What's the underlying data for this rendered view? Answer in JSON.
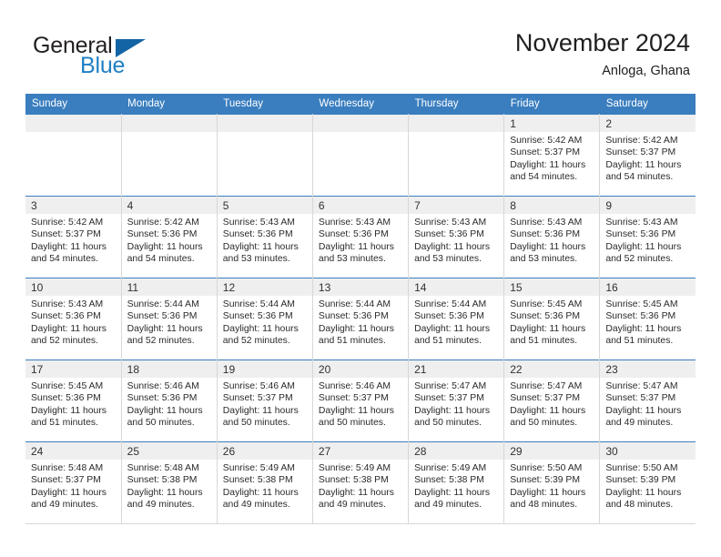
{
  "brand": {
    "name_part1": "General",
    "name_part2": "Blue",
    "triangle_color": "#1364a5",
    "accent_color": "#1f7fc4"
  },
  "header": {
    "title": "November 2024",
    "subtitle": "Anloga, Ghana"
  },
  "theme": {
    "header_bg": "#3a7ebf",
    "header_text": "#ffffff",
    "daynum_band_bg": "#efefef",
    "cell_bg": "#ffffff",
    "grid_line": "#d7d7d7"
  },
  "weekday_headers": [
    "Sunday",
    "Monday",
    "Tuesday",
    "Wednesday",
    "Thursday",
    "Friday",
    "Saturday"
  ],
  "weeks": [
    [
      {
        "day": "",
        "empty": true,
        "sunrise": "",
        "sunset": "",
        "daylight_line1": "",
        "daylight_line2": ""
      },
      {
        "day": "",
        "empty": true,
        "sunrise": "",
        "sunset": "",
        "daylight_line1": "",
        "daylight_line2": ""
      },
      {
        "day": "",
        "empty": true,
        "sunrise": "",
        "sunset": "",
        "daylight_line1": "",
        "daylight_line2": ""
      },
      {
        "day": "",
        "empty": true,
        "sunrise": "",
        "sunset": "",
        "daylight_line1": "",
        "daylight_line2": ""
      },
      {
        "day": "",
        "empty": true,
        "sunrise": "",
        "sunset": "",
        "daylight_line1": "",
        "daylight_line2": ""
      },
      {
        "day": "1",
        "empty": false,
        "sunrise": "Sunrise: 5:42 AM",
        "sunset": "Sunset: 5:37 PM",
        "daylight_line1": "Daylight: 11 hours",
        "daylight_line2": "and 54 minutes."
      },
      {
        "day": "2",
        "empty": false,
        "sunrise": "Sunrise: 5:42 AM",
        "sunset": "Sunset: 5:37 PM",
        "daylight_line1": "Daylight: 11 hours",
        "daylight_line2": "and 54 minutes."
      }
    ],
    [
      {
        "day": "3",
        "empty": false,
        "sunrise": "Sunrise: 5:42 AM",
        "sunset": "Sunset: 5:37 PM",
        "daylight_line1": "Daylight: 11 hours",
        "daylight_line2": "and 54 minutes."
      },
      {
        "day": "4",
        "empty": false,
        "sunrise": "Sunrise: 5:42 AM",
        "sunset": "Sunset: 5:36 PM",
        "daylight_line1": "Daylight: 11 hours",
        "daylight_line2": "and 54 minutes."
      },
      {
        "day": "5",
        "empty": false,
        "sunrise": "Sunrise: 5:43 AM",
        "sunset": "Sunset: 5:36 PM",
        "daylight_line1": "Daylight: 11 hours",
        "daylight_line2": "and 53 minutes."
      },
      {
        "day": "6",
        "empty": false,
        "sunrise": "Sunrise: 5:43 AM",
        "sunset": "Sunset: 5:36 PM",
        "daylight_line1": "Daylight: 11 hours",
        "daylight_line2": "and 53 minutes."
      },
      {
        "day": "7",
        "empty": false,
        "sunrise": "Sunrise: 5:43 AM",
        "sunset": "Sunset: 5:36 PM",
        "daylight_line1": "Daylight: 11 hours",
        "daylight_line2": "and 53 minutes."
      },
      {
        "day": "8",
        "empty": false,
        "sunrise": "Sunrise: 5:43 AM",
        "sunset": "Sunset: 5:36 PM",
        "daylight_line1": "Daylight: 11 hours",
        "daylight_line2": "and 53 minutes."
      },
      {
        "day": "9",
        "empty": false,
        "sunrise": "Sunrise: 5:43 AM",
        "sunset": "Sunset: 5:36 PM",
        "daylight_line1": "Daylight: 11 hours",
        "daylight_line2": "and 52 minutes."
      }
    ],
    [
      {
        "day": "10",
        "empty": false,
        "sunrise": "Sunrise: 5:43 AM",
        "sunset": "Sunset: 5:36 PM",
        "daylight_line1": "Daylight: 11 hours",
        "daylight_line2": "and 52 minutes."
      },
      {
        "day": "11",
        "empty": false,
        "sunrise": "Sunrise: 5:44 AM",
        "sunset": "Sunset: 5:36 PM",
        "daylight_line1": "Daylight: 11 hours",
        "daylight_line2": "and 52 minutes."
      },
      {
        "day": "12",
        "empty": false,
        "sunrise": "Sunrise: 5:44 AM",
        "sunset": "Sunset: 5:36 PM",
        "daylight_line1": "Daylight: 11 hours",
        "daylight_line2": "and 52 minutes."
      },
      {
        "day": "13",
        "empty": false,
        "sunrise": "Sunrise: 5:44 AM",
        "sunset": "Sunset: 5:36 PM",
        "daylight_line1": "Daylight: 11 hours",
        "daylight_line2": "and 51 minutes."
      },
      {
        "day": "14",
        "empty": false,
        "sunrise": "Sunrise: 5:44 AM",
        "sunset": "Sunset: 5:36 PM",
        "daylight_line1": "Daylight: 11 hours",
        "daylight_line2": "and 51 minutes."
      },
      {
        "day": "15",
        "empty": false,
        "sunrise": "Sunrise: 5:45 AM",
        "sunset": "Sunset: 5:36 PM",
        "daylight_line1": "Daylight: 11 hours",
        "daylight_line2": "and 51 minutes."
      },
      {
        "day": "16",
        "empty": false,
        "sunrise": "Sunrise: 5:45 AM",
        "sunset": "Sunset: 5:36 PM",
        "daylight_line1": "Daylight: 11 hours",
        "daylight_line2": "and 51 minutes."
      }
    ],
    [
      {
        "day": "17",
        "empty": false,
        "sunrise": "Sunrise: 5:45 AM",
        "sunset": "Sunset: 5:36 PM",
        "daylight_line1": "Daylight: 11 hours",
        "daylight_line2": "and 51 minutes."
      },
      {
        "day": "18",
        "empty": false,
        "sunrise": "Sunrise: 5:46 AM",
        "sunset": "Sunset: 5:36 PM",
        "daylight_line1": "Daylight: 11 hours",
        "daylight_line2": "and 50 minutes."
      },
      {
        "day": "19",
        "empty": false,
        "sunrise": "Sunrise: 5:46 AM",
        "sunset": "Sunset: 5:37 PM",
        "daylight_line1": "Daylight: 11 hours",
        "daylight_line2": "and 50 minutes."
      },
      {
        "day": "20",
        "empty": false,
        "sunrise": "Sunrise: 5:46 AM",
        "sunset": "Sunset: 5:37 PM",
        "daylight_line1": "Daylight: 11 hours",
        "daylight_line2": "and 50 minutes."
      },
      {
        "day": "21",
        "empty": false,
        "sunrise": "Sunrise: 5:47 AM",
        "sunset": "Sunset: 5:37 PM",
        "daylight_line1": "Daylight: 11 hours",
        "daylight_line2": "and 50 minutes."
      },
      {
        "day": "22",
        "empty": false,
        "sunrise": "Sunrise: 5:47 AM",
        "sunset": "Sunset: 5:37 PM",
        "daylight_line1": "Daylight: 11 hours",
        "daylight_line2": "and 50 minutes."
      },
      {
        "day": "23",
        "empty": false,
        "sunrise": "Sunrise: 5:47 AM",
        "sunset": "Sunset: 5:37 PM",
        "daylight_line1": "Daylight: 11 hours",
        "daylight_line2": "and 49 minutes."
      }
    ],
    [
      {
        "day": "24",
        "empty": false,
        "sunrise": "Sunrise: 5:48 AM",
        "sunset": "Sunset: 5:37 PM",
        "daylight_line1": "Daylight: 11 hours",
        "daylight_line2": "and 49 minutes."
      },
      {
        "day": "25",
        "empty": false,
        "sunrise": "Sunrise: 5:48 AM",
        "sunset": "Sunset: 5:38 PM",
        "daylight_line1": "Daylight: 11 hours",
        "daylight_line2": "and 49 minutes."
      },
      {
        "day": "26",
        "empty": false,
        "sunrise": "Sunrise: 5:49 AM",
        "sunset": "Sunset: 5:38 PM",
        "daylight_line1": "Daylight: 11 hours",
        "daylight_line2": "and 49 minutes."
      },
      {
        "day": "27",
        "empty": false,
        "sunrise": "Sunrise: 5:49 AM",
        "sunset": "Sunset: 5:38 PM",
        "daylight_line1": "Daylight: 11 hours",
        "daylight_line2": "and 49 minutes."
      },
      {
        "day": "28",
        "empty": false,
        "sunrise": "Sunrise: 5:49 AM",
        "sunset": "Sunset: 5:38 PM",
        "daylight_line1": "Daylight: 11 hours",
        "daylight_line2": "and 49 minutes."
      },
      {
        "day": "29",
        "empty": false,
        "sunrise": "Sunrise: 5:50 AM",
        "sunset": "Sunset: 5:39 PM",
        "daylight_line1": "Daylight: 11 hours",
        "daylight_line2": "and 48 minutes."
      },
      {
        "day": "30",
        "empty": false,
        "sunrise": "Sunrise: 5:50 AM",
        "sunset": "Sunset: 5:39 PM",
        "daylight_line1": "Daylight: 11 hours",
        "daylight_line2": "and 48 minutes."
      }
    ]
  ]
}
